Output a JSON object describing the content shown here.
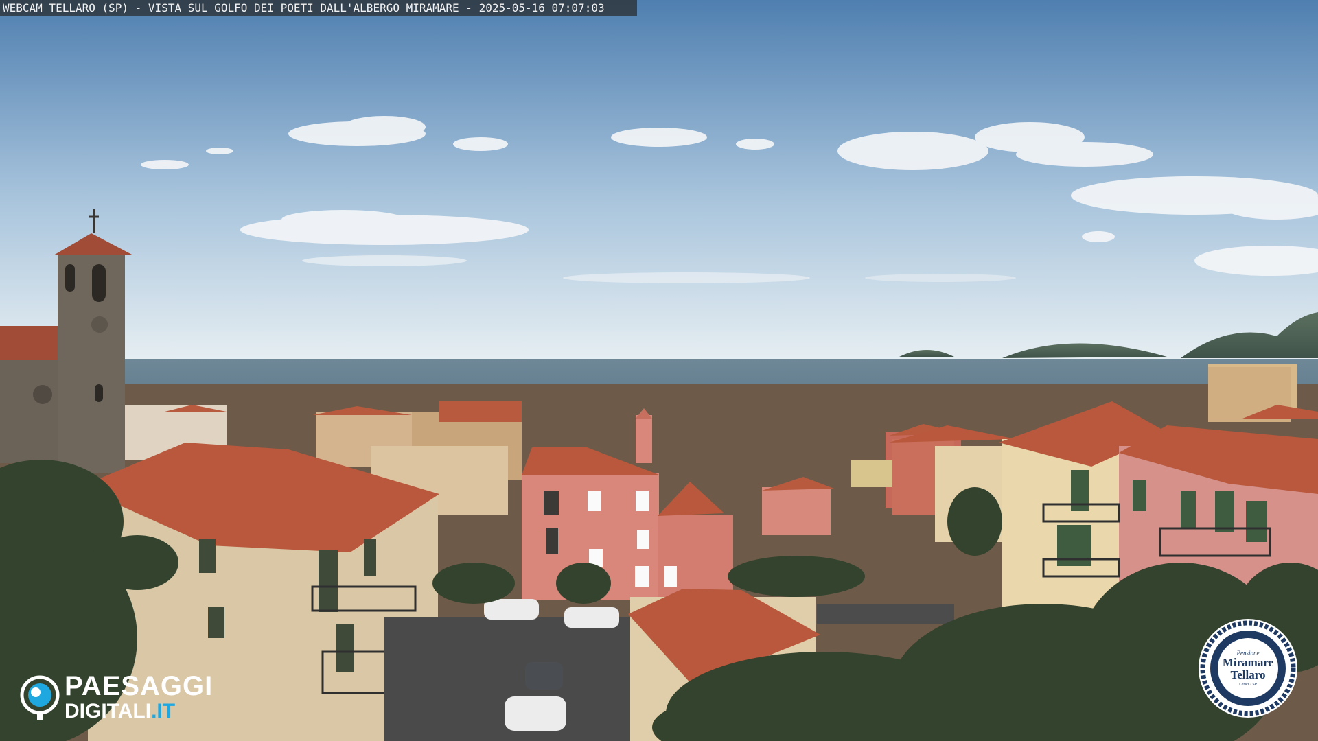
{
  "camera_caption": "WEBCAM TELLARO (SP) - VISTA SUL GOLFO DEI POETI DALL'ALBERGO MIRAMARE - 2025-05-16 07:07:03",
  "logo": {
    "line1": "PAESAGGI",
    "line2_main": "DIGITALI",
    "line2_suffix": ".IT",
    "accent_color": "#1fa7e0"
  },
  "hotel_badge": {
    "top": "Pensione",
    "name_line1": "Miramare",
    "name_line2": "Tellaro",
    "bottom": "Lerici · SP",
    "color": "#1e3a63"
  },
  "colors": {
    "sky_top": "#4f7fb0",
    "sky_horizon": "#e6eef2",
    "sea": "#4d6b80",
    "roof": "#b85a3e"
  }
}
